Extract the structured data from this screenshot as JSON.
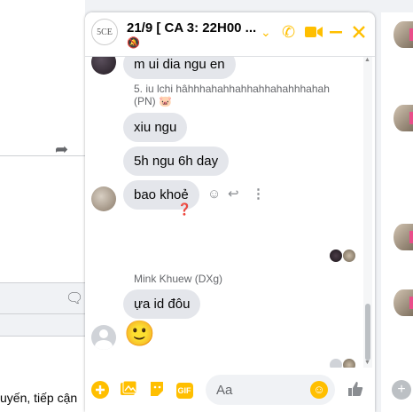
{
  "chat": {
    "title": "21/9 [ CA 3: 22H00 ...",
    "avatar_text": "5CE",
    "header_icons": [
      "chevron-down-icon",
      "phone-icon",
      "video-icon",
      "minimize-icon",
      "close-icon"
    ]
  },
  "messages": {
    "partial_top": "m ui dia ngu en",
    "sender_1": "5. iu lchi hâhhhahahhahhahhahahhhahah (PN) 🐷",
    "m1": "xiu ngu",
    "m2": "5h ngu 6h day",
    "m3": "bao khoẻ",
    "reaction": "❓",
    "sender_2": "Mink Khuew (DXg)",
    "m4": "ựa id đôu",
    "emoji": "🙂"
  },
  "footer": {
    "placeholder": "Aa",
    "icons": [
      "add-circle-icon",
      "photo-icon",
      "sticker-icon",
      "gif-icon",
      "emoji-icon",
      "thumbs-up-icon"
    ],
    "gif_label": "GIF"
  },
  "background": {
    "partial_text": "uyến, tiếp cận"
  },
  "colors": {
    "accent": "#ffbf00",
    "bubble": "#e4e6eb",
    "secondary_text": "#65676b"
  }
}
